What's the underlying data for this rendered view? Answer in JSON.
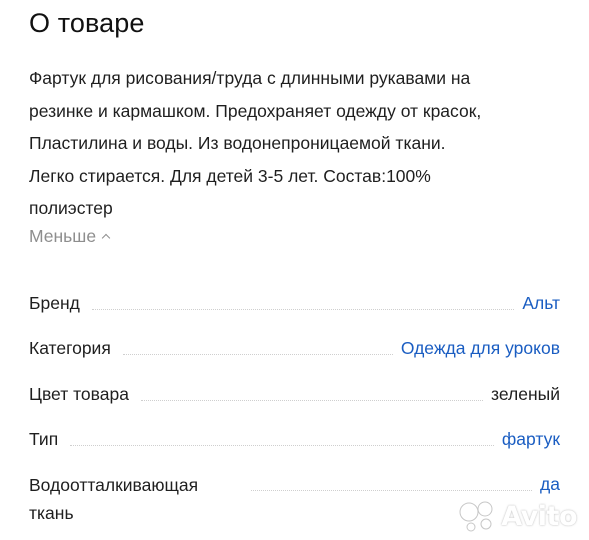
{
  "section": {
    "title": "О товаре"
  },
  "description": {
    "lines": [
      "Фартук для рисования/труда с длинными рукавами на",
      "резинке и кармашком. Предохраняет одежду от красок,",
      "Пластилина и воды. Из водонепроницаемой ткани.",
      "Легко стирается. Для детей 3-5 лет. Состав:100%",
      "полиэстер"
    ],
    "toggle_label": "Меньше"
  },
  "specs": [
    {
      "label": "Бренд",
      "value": "Альт",
      "link": true
    },
    {
      "label": "Категория",
      "value": "Одежда для уроков",
      "link": true
    },
    {
      "label": "Цвет товара",
      "value": "зеленый",
      "link": false
    },
    {
      "label": "Тип",
      "value": "фартук",
      "link": true
    },
    {
      "label": "Водоотталкивающая ткань",
      "value": "да",
      "link": true
    }
  ],
  "watermark": {
    "text": "Avito",
    "icon": "avito-logo-icon"
  },
  "colors": {
    "link": "#1a5dc2",
    "muted": "#8e8e8e",
    "text": "#1f1f1f",
    "dots": "#cfcfcf"
  }
}
